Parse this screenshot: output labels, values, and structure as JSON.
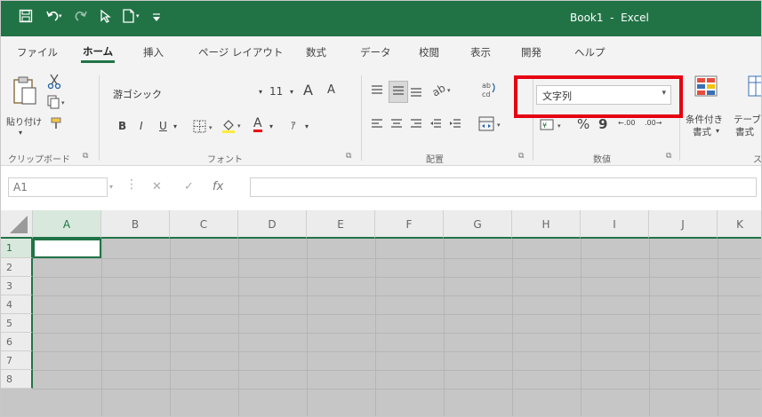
{
  "titlebar": {
    "title": "Book1  -  Excel",
    "bg_color": "#217346",
    "qat_icons": [
      "save-icon",
      "undo-icon",
      "redo-icon",
      "touch-mode-icon",
      "new-document-icon",
      "customize-qat-icon"
    ]
  },
  "tabs": [
    "ファイル",
    "ホーム",
    "挿入",
    "ページ レイアウト",
    "数式",
    "データ",
    "校閲",
    "表示",
    "開発",
    "ヘルプ"
  ],
  "active_tab": "ホーム",
  "ribbon": {
    "clipboard": {
      "paste_label": "貼り付け",
      "group_label": "クリップボード"
    },
    "font": {
      "font_name": "游ゴシック",
      "font_size": "11",
      "grow_label": "A",
      "shrink_label": "A",
      "bold": "B",
      "italic": "I",
      "underline": "U",
      "font_color_label": "A",
      "phonetic_label": "ｱ",
      "group_label": "フォント"
    },
    "alignment": {
      "group_label": "配置"
    },
    "number": {
      "format_value": "文字列",
      "percent": "%",
      "comma": "9",
      "increase_decimal": "←.00",
      "decrease_decimal": ".00→",
      "group_label": "数値"
    },
    "styles": {
      "conditional_label_1": "条件付き",
      "conditional_label_2": "書式",
      "table_label_1": "テーブ",
      "table_label_2": "書式"
    },
    "truncated_label": "ス"
  },
  "highlight_color": "#e60012",
  "formula_bar": {
    "name_box": "A1",
    "fx_label": "fx"
  },
  "grid": {
    "columns": [
      "A",
      "B",
      "C",
      "D",
      "E",
      "F",
      "G",
      "H",
      "I",
      "J",
      "K"
    ],
    "rows": [
      "1",
      "2",
      "3",
      "4",
      "5",
      "6",
      "7",
      "8"
    ],
    "selected_cell": "A1"
  }
}
